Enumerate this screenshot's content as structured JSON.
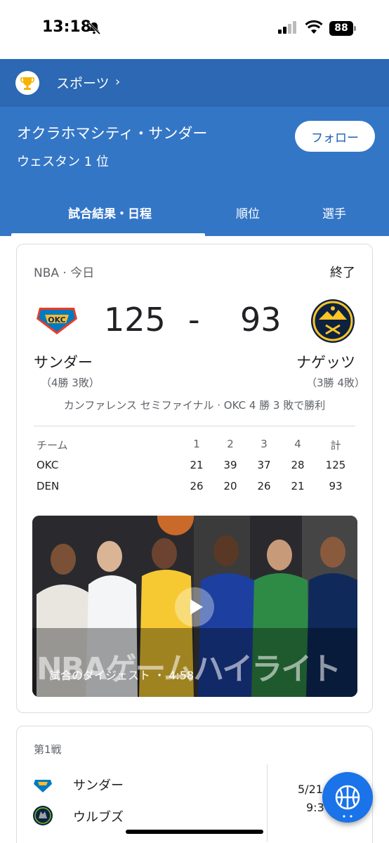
{
  "status_bar": {
    "time": "13:18",
    "battery": "88"
  },
  "breadcrumb": {
    "label": "スポーツ",
    "chevron": "›"
  },
  "team_header": {
    "name": "オクラホマシティ・サンダー",
    "rank": "ウェスタン 1 位",
    "follow_label": "フォロー"
  },
  "tabs": [
    {
      "label": "試合結果・日程",
      "active": true
    },
    {
      "label": "順位",
      "active": false
    },
    {
      "label": "選手",
      "active": false
    }
  ],
  "game": {
    "league": "NBA · 今日",
    "status": "終了",
    "home": {
      "name": "サンダー",
      "record": "（4勝 3敗）",
      "score": "125",
      "logo": "okc-thunder-logo"
    },
    "away": {
      "name": "ナゲッツ",
      "record": "（3勝 4敗）",
      "score": "93",
      "logo": "denver-nuggets-logo"
    },
    "dash": "-",
    "series_note": "カンファレンス セミファイナル · OKC 4 勝 3 敗で勝利",
    "box_score": {
      "headers": [
        "チーム",
        "1",
        "2",
        "3",
        "4",
        "計"
      ],
      "rows": [
        [
          "OKC",
          "21",
          "39",
          "37",
          "28",
          "125"
        ],
        [
          "DEN",
          "26",
          "20",
          "26",
          "21",
          "93"
        ]
      ]
    },
    "video": {
      "overlay_title": "NBAゲームハイライト",
      "caption": "試合のダイジェスト ・ 4:58",
      "icon": "play-icon"
    }
  },
  "next_game": {
    "label": "第1戦",
    "teams": [
      {
        "name": "サンダー",
        "logo": "okc-thunder-logo"
      },
      {
        "name": "ウルブズ",
        "logo": "timberwolves-logo"
      }
    ],
    "date": "5/21",
    "time": "9:3"
  },
  "colors": {
    "header_blue": "#3476c6",
    "breadcrumb_blue": "#2c68b3",
    "fab_blue": "#1a73e8",
    "text": "#202124",
    "muted": "#5f6368"
  },
  "fab_icon": "basketball-icon"
}
